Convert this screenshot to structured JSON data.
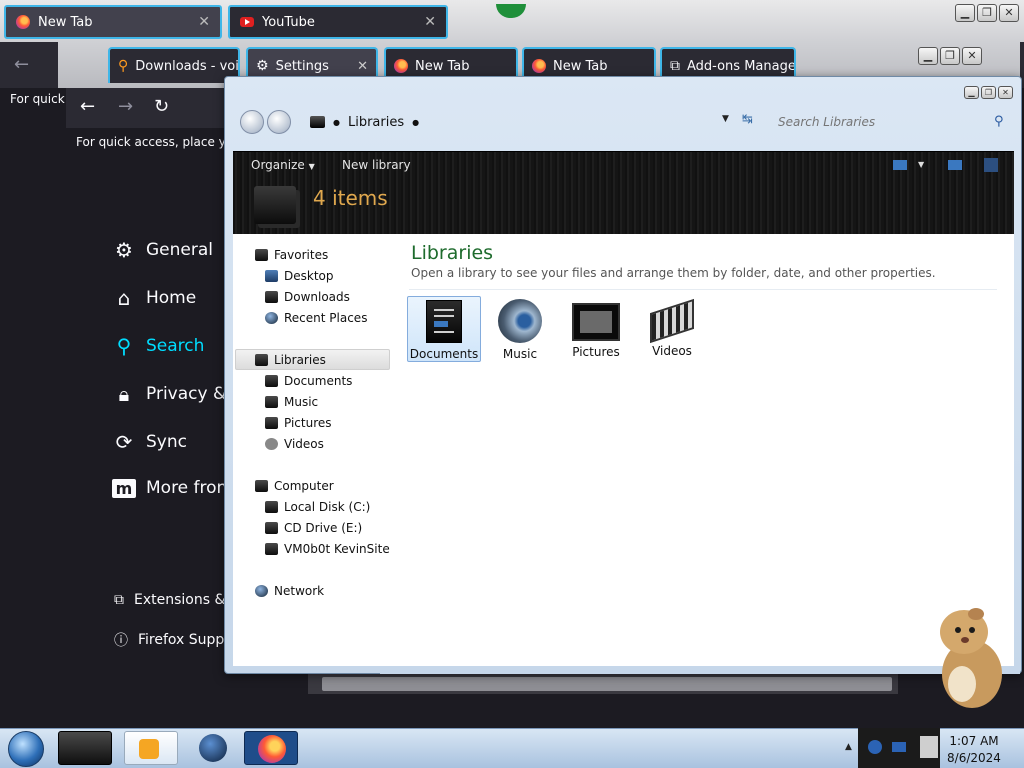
{
  "back_window": {
    "tabs": [
      "New Tab",
      "YouTube"
    ],
    "partial_text": "For quick"
  },
  "settings_window": {
    "tabs": [
      "Downloads - voic",
      "Settings",
      "New Tab",
      "New Tab",
      "Add-ons Manager"
    ],
    "quick_access_text": "For quick access, place your",
    "nav": {
      "general": "General",
      "home": "Home",
      "search": "Search",
      "privacy": "Privacy & S",
      "sync": "Sync",
      "more": "More from"
    },
    "extensions": "Extensions &",
    "support": "Firefox Suppo"
  },
  "explorer": {
    "breadcrumb": "Libraries",
    "search_placeholder": "Search Libraries",
    "toolbar": {
      "organize": "Organize",
      "new_library": "New library"
    },
    "items_count": "4 items",
    "nav_pane": {
      "favorites": "Favorites",
      "favorites_items": [
        "Desktop",
        "Downloads",
        "Recent Places"
      ],
      "libraries": "Libraries",
      "libraries_items": [
        "Documents",
        "Music",
        "Pictures",
        "Videos"
      ],
      "computer": "Computer",
      "computer_items": [
        "Local Disk (C:)",
        "CD Drive (E:)",
        "VM0b0t KevinSite"
      ],
      "network": "Network"
    },
    "content": {
      "heading": "Libraries",
      "subtitle": "Open a library to see your files and arrange them by folder, date, and other properties.",
      "libraries": [
        "Documents",
        "Music",
        "Pictures",
        "Videos"
      ]
    }
  },
  "taskbar": {
    "time": "1:07 AM",
    "date": "8/6/2024"
  }
}
